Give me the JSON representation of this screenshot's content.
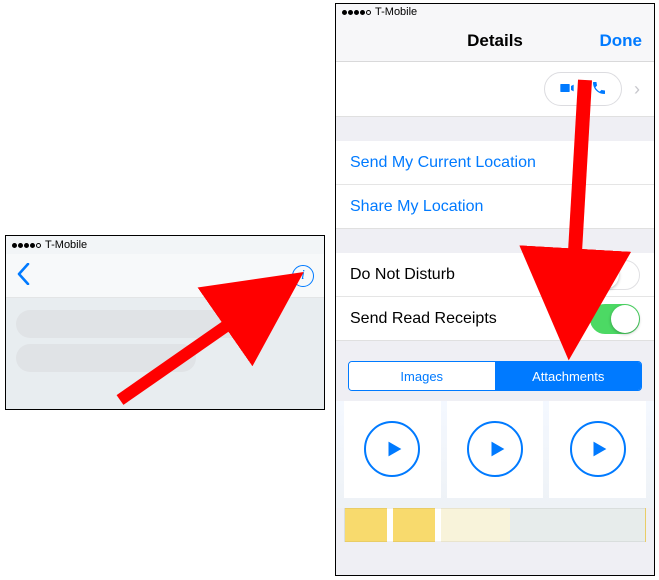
{
  "left": {
    "carrier": "T-Mobile",
    "info_glyph": "i"
  },
  "right": {
    "carrier": "T-Mobile",
    "title": "Details",
    "done": "Done",
    "location": {
      "send_current": "Send My Current Location",
      "share": "Share My Location"
    },
    "settings": {
      "dnd": "Do Not Disturb",
      "read_receipts": "Send Read Receipts"
    },
    "tabs": {
      "images": "Images",
      "attachments": "Attachments"
    },
    "chevron": "›"
  }
}
